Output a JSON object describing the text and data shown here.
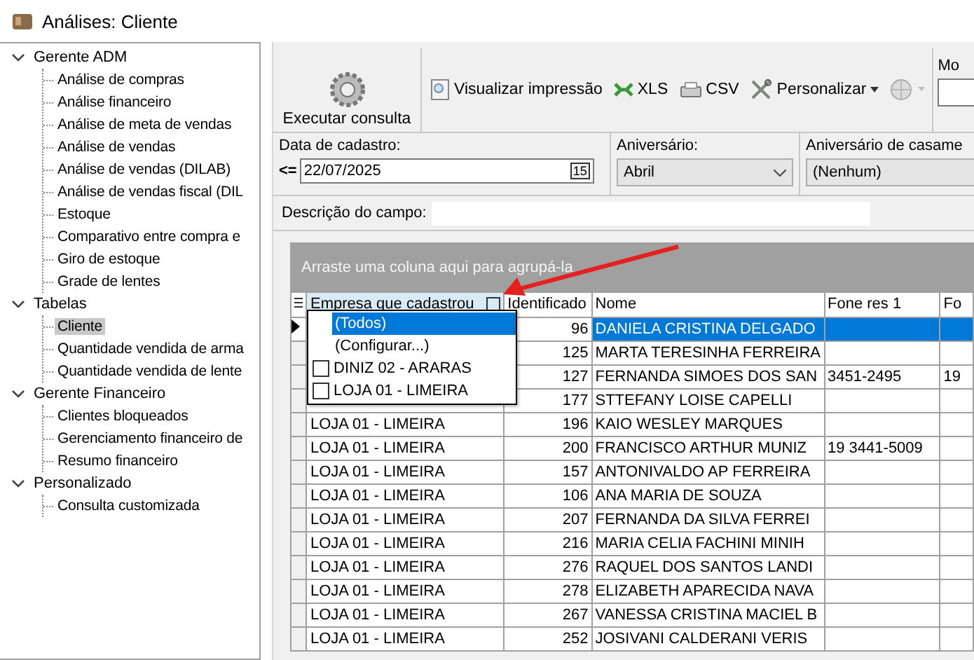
{
  "window": {
    "title": "Análises: Cliente"
  },
  "tree": [
    {
      "label": "Gerente ADM",
      "expanded": true,
      "selected": false,
      "children": [
        {
          "label": "Análise de compras",
          "selected": false
        },
        {
          "label": "Análise financeiro",
          "selected": false
        },
        {
          "label": "Análise de meta de vendas",
          "selected": false
        },
        {
          "label": "Análise de vendas",
          "selected": false
        },
        {
          "label": "Análise de vendas (DILAB)",
          "selected": false
        },
        {
          "label": "Análise de vendas fiscal (DIL",
          "selected": false
        },
        {
          "label": "Estoque",
          "selected": false
        },
        {
          "label": "Comparativo entre compra e",
          "selected": false
        },
        {
          "label": "Giro de estoque",
          "selected": false
        },
        {
          "label": "Grade de lentes",
          "selected": false
        }
      ]
    },
    {
      "label": "Tabelas",
      "expanded": true,
      "selected": false,
      "children": [
        {
          "label": "Cliente",
          "selected": true
        },
        {
          "label": "Quantidade vendida de arma",
          "selected": false
        },
        {
          "label": "Quantidade vendida de lente",
          "selected": false
        }
      ]
    },
    {
      "label": "Gerente Financeiro",
      "expanded": true,
      "selected": false,
      "children": [
        {
          "label": "Clientes bloqueados",
          "selected": false
        },
        {
          "label": "Gerenciamento financeiro de",
          "selected": false
        },
        {
          "label": "Resumo financeiro",
          "selected": false
        }
      ]
    },
    {
      "label": "Personalizado",
      "expanded": true,
      "selected": false,
      "children": [
        {
          "label": "Consulta customizada",
          "selected": false
        }
      ]
    }
  ],
  "toolbar": {
    "run": "Executar consulta",
    "items": [
      {
        "label": "Visualizar impressão",
        "kind": "preview"
      },
      {
        "label": "XLS",
        "kind": "xls"
      },
      {
        "label": "CSV",
        "kind": "csv"
      },
      {
        "label": "Personalizar",
        "kind": "customize"
      }
    ],
    "cut_label": "Mo"
  },
  "filters": {
    "date_label": "Data de cadastro:",
    "operator": "<=",
    "date": "22/07/2025",
    "calendar": "15",
    "birthday_label": "Aniversário:",
    "birthday": "Abril",
    "wedding_label": "Aniversário de casame",
    "wedding": "(Nenhum)",
    "description_label": "Descrição do campo:"
  },
  "grid": {
    "group_hint": "Arraste uma coluna aqui para agrupá-la",
    "columns": [
      "Empresa que cadastrou",
      "Identificado",
      "Nome",
      "Fone res 1",
      "Fo"
    ],
    "rows": [
      {
        "selected": true,
        "cells": [
          "",
          "96",
          "DANIELA CRISTINA DELGADO",
          "",
          ""
        ]
      },
      {
        "selected": false,
        "cells": [
          "",
          "125",
          "MARTA TERESINHA FERREIRA",
          "",
          ""
        ]
      },
      {
        "selected": false,
        "cells": [
          "",
          "127",
          "FERNANDA SIMOES DOS SAN",
          "3451-2495",
          "19"
        ]
      },
      {
        "selected": false,
        "cells": [
          "",
          "177",
          "STTEFANY LOISE CAPELLI",
          "",
          ""
        ]
      },
      {
        "selected": false,
        "cells": [
          "LOJA 01 - LIMEIRA",
          "196",
          "KAIO WESLEY MARQUES",
          "",
          ""
        ]
      },
      {
        "selected": false,
        "cells": [
          "LOJA 01 - LIMEIRA",
          "200",
          "FRANCISCO ARTHUR MUNIZ",
          "19 3441-5009",
          ""
        ]
      },
      {
        "selected": false,
        "cells": [
          "LOJA 01 - LIMEIRA",
          "157",
          "ANTONIVALDO AP FERREIRA",
          "",
          ""
        ]
      },
      {
        "selected": false,
        "cells": [
          "LOJA 01 - LIMEIRA",
          "106",
          "ANA MARIA DE SOUZA",
          "",
          ""
        ]
      },
      {
        "selected": false,
        "cells": [
          "LOJA 01 - LIMEIRA",
          "207",
          "FERNANDA DA SILVA FERREI",
          "",
          ""
        ]
      },
      {
        "selected": false,
        "cells": [
          "LOJA 01 - LIMEIRA",
          "216",
          "MARIA CELIA FACHINI MINIH",
          "",
          ""
        ]
      },
      {
        "selected": false,
        "cells": [
          "LOJA 01 - LIMEIRA",
          "276",
          "RAQUEL DOS SANTOS  LANDI",
          "",
          ""
        ]
      },
      {
        "selected": false,
        "cells": [
          "LOJA 01 - LIMEIRA",
          "278",
          "ELIZABETH APARECIDA NAVA",
          "",
          ""
        ]
      },
      {
        "selected": false,
        "cells": [
          "LOJA 01 - LIMEIRA",
          "267",
          "VANESSA CRISTINA MACIEL B",
          "",
          ""
        ]
      },
      {
        "selected": false,
        "cells": [
          "LOJA 01 - LIMEIRA",
          "252",
          "JOSIVANI  CALDERANI  VERIS",
          "",
          ""
        ]
      }
    ],
    "filter_popup": [
      {
        "kind": "option",
        "label": "(Todos)",
        "selected": true
      },
      {
        "kind": "option",
        "label": "(Configurar...)",
        "selected": false
      },
      {
        "kind": "check",
        "label": "DINIZ 02 - ARARAS",
        "checked": false
      },
      {
        "kind": "check",
        "label": "LOJA 01 - LIMEIRA",
        "checked": false
      }
    ]
  }
}
